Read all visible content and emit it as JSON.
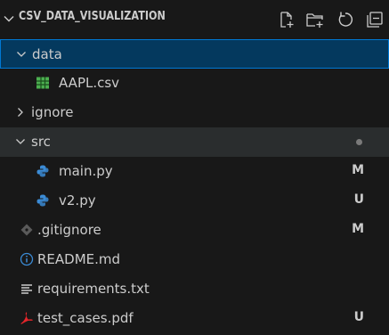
{
  "explorer": {
    "section_title": "CSV_DATA_VISUALIZATION",
    "toolbar": {
      "new_file_icon": "new-file-icon",
      "new_folder_icon": "new-folder-icon",
      "refresh_icon": "refresh-icon",
      "collapse_all_icon": "collapse-all-icon"
    },
    "tree": [
      {
        "label": "data",
        "type": "folder",
        "expanded": true
      },
      {
        "label": "AAPL.csv",
        "type": "file",
        "icon": "csv-icon"
      },
      {
        "label": "ignore",
        "type": "folder",
        "expanded": false
      },
      {
        "label": "src",
        "type": "folder",
        "expanded": true
      },
      {
        "label": "main.py",
        "type": "file",
        "icon": "python-icon",
        "status": "M"
      },
      {
        "label": "v2.py",
        "type": "file",
        "icon": "python-icon",
        "status": "U"
      },
      {
        "label": ".gitignore",
        "type": "file",
        "icon": "git-icon",
        "status": "M"
      },
      {
        "label": "README.md",
        "type": "file",
        "icon": "info-icon"
      },
      {
        "label": "requirements.txt",
        "type": "file",
        "icon": "text-lines-icon"
      },
      {
        "label": "test_cases.pdf",
        "type": "file",
        "icon": "pdf-icon",
        "status": "U"
      }
    ]
  },
  "colors": {
    "background": "#181818",
    "selection": "#04395e",
    "focus_border": "#0078d4",
    "csv_green": "#4caf50",
    "python_blue": "#3b8bd5",
    "pdf_red": "#e5252a"
  }
}
